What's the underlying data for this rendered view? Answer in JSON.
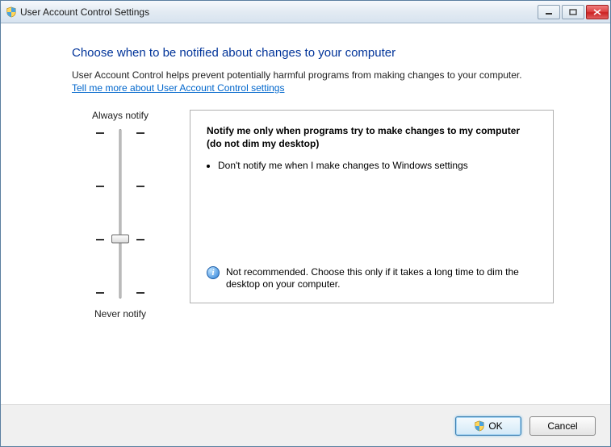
{
  "window": {
    "title": "User Account Control Settings"
  },
  "main": {
    "heading": "Choose when to be notified about changes to your computer",
    "description": "User Account Control helps prevent potentially harmful programs from making changes to your computer.",
    "link": "Tell me more about User Account Control settings"
  },
  "slider": {
    "top_label": "Always notify",
    "bottom_label": "Never notify",
    "levels": 4,
    "current_level": 1
  },
  "panel": {
    "heading": "Notify me only when programs try to make changes to my computer (do not dim my desktop)",
    "bullets": [
      "Don't notify me when I make changes to Windows settings"
    ],
    "note": "Not recommended. Choose this only if it takes a long time to dim the desktop on your computer."
  },
  "footer": {
    "ok": "OK",
    "cancel": "Cancel"
  }
}
